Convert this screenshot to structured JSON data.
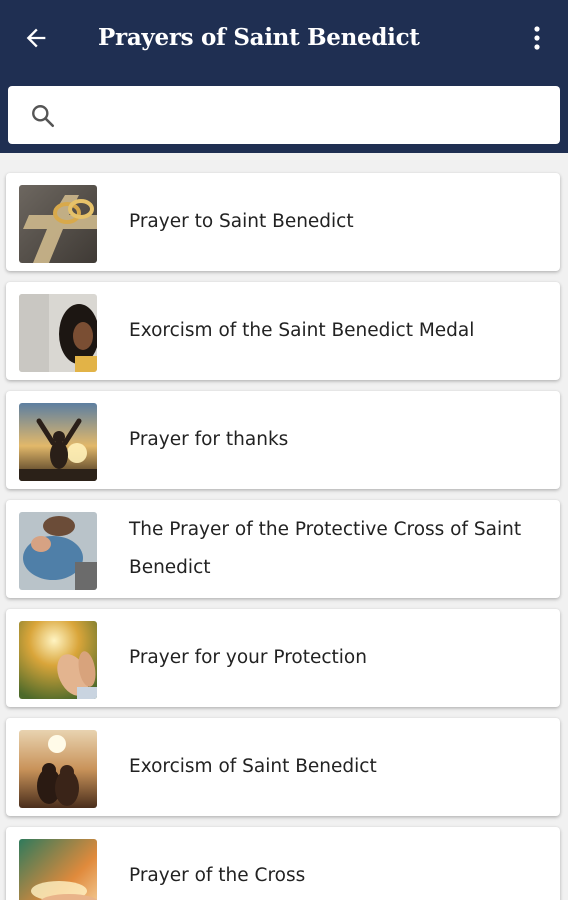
{
  "app_bar": {
    "title": "Prayers of Saint Benedict",
    "back_icon": "arrow-left-icon",
    "menu_icon": "more-vertical-icon",
    "color": "#1f2f52"
  },
  "search": {
    "value": "",
    "placeholder": "",
    "icon": "search-icon"
  },
  "prayers": [
    {
      "title": "Prayer to Saint Benedict",
      "image": "wedding-rings-on-cross"
    },
    {
      "title": "Exorcism of the Saint Benedict Medal",
      "image": "woman-praying"
    },
    {
      "title": "Prayer for thanks",
      "image": "man-raising-arms-at-sunset"
    },
    {
      "title": "The Prayer of the Protective Cross of Saint Benedict",
      "image": "person-kneeling-in-prayer"
    },
    {
      "title": "Prayer for your Protection",
      "image": "open-hands-in-sunlight"
    },
    {
      "title": "Exorcism of Saint Benedict",
      "image": "couple-at-sunrise"
    },
    {
      "title": "Prayer of the Cross",
      "image": "hands-with-light"
    }
  ]
}
